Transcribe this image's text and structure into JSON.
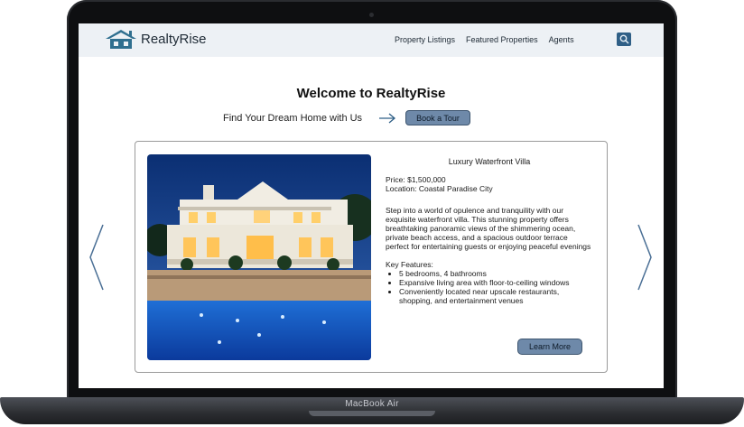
{
  "device": {
    "label": "MacBook Air"
  },
  "navbar": {
    "brand": "RealtyRise",
    "links": [
      "Property Listings",
      "Featured Properties",
      "Agents"
    ],
    "search_icon": "search-icon"
  },
  "hero": {
    "title": "Welcome to RealtyRise",
    "tagline": "Find Your Dream Home with Us",
    "cta": "Book a Tour"
  },
  "property": {
    "title": "Luxury Waterfront Villa",
    "price": "Price: $1,500,000",
    "location": "Location: Coastal Paradise City",
    "description": "Step into a world of opulence and tranquility with our exquisite waterfront villa. This stunning property offers breathtaking panoramic views of the shimmering ocean, private beach access, and a spacious outdoor terrace perfect for entertaining guests or enjoying peaceful evenings",
    "features_heading": "Key Features:",
    "features": [
      "5 bedrooms, 4 bathrooms",
      "Expansive living area with floor-to-ceiling windows",
      "Conveniently located near upscale restaurants, shopping, and entertainment venues"
    ],
    "learn_more": "Learn More"
  },
  "colors": {
    "accent": "#6e89a9",
    "navbar_bg": "#edf1f5",
    "brand_icon": "#2f6f8f"
  }
}
